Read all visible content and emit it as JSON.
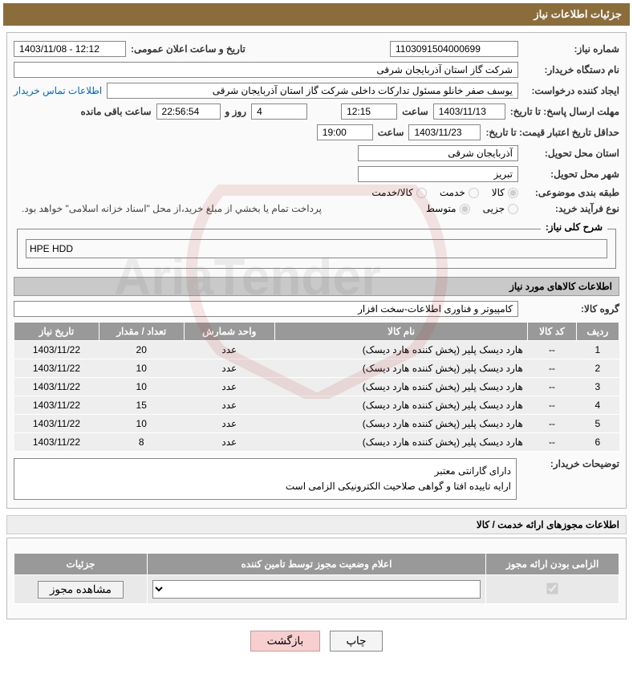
{
  "header": {
    "title": "جزئیات اطلاعات نیاز"
  },
  "info": {
    "need_number_label": "شماره نیاز:",
    "need_number": "1103091504000699",
    "announce_label": "تاریخ و ساعت اعلان عمومی:",
    "announce_value": "1403/11/08 - 12:12",
    "buyer_device_label": "نام دستگاه خریدار:",
    "buyer_device": "شرکت گاز استان آذربایجان شرقی",
    "requester_label": "ایجاد کننده درخواست:",
    "requester": "یوسف صفر خانلو  مسئول تدارکات داخلی  شرکت گاز استان آذربایجان شرقی",
    "contact_link": "اطلاعات تماس خریدار",
    "deadline_send_label": "مهلت ارسال پاسخ: تا تاریخ:",
    "deadline_send_date": "1403/11/13",
    "saat_label": "ساعت",
    "deadline_send_time": "12:15",
    "remain_days": "4",
    "remain_days_label": "روز و",
    "remain_time": "22:56:54",
    "remain_time_label": "ساعت باقی مانده",
    "min_valid_label": "حداقل تاریخ اعتبار قیمت: تا تاریخ:",
    "min_valid_date": "1403/11/23",
    "min_valid_time": "19:00",
    "province_label": "استان محل تحویل:",
    "province": "آذربایجان شرقی",
    "city_label": "شهر محل تحویل:",
    "city": "تبریز",
    "cat_label": "طبقه بندی موضوعی:",
    "cat_kala": "کالا",
    "cat_service": "خدمت",
    "cat_both": "کالا/خدمت",
    "buy_process_label": "نوع فرآیند خرید:",
    "bp_partial": "جزیی",
    "bp_medium": "متوسط",
    "buy_note": "پرداخت تمام يا بخشي از مبلغ خريد،از محل \"اسناد خزانه اسلامی\" خواهد بود."
  },
  "summary": {
    "legend": "شرح کلی نیاز:",
    "value": "HPE HDD"
  },
  "goods_section_title": "اطلاعات کالاهای مورد نیاز",
  "goods_group": {
    "label": "گروه کالا:",
    "value": "کامپیوتر و فناوری اطلاعات-سخت افزار"
  },
  "table": {
    "headers": {
      "row": "ردیف",
      "code": "کد کالا",
      "name": "نام کالا",
      "unit": "واحد شمارش",
      "qty": "تعداد / مقدار",
      "date": "تاریخ نیاز"
    },
    "rows": [
      {
        "idx": "1",
        "code": "--",
        "name": "هارد دیسک پلیر (پخش‌ کننده هارد دیسک)",
        "unit": "عدد",
        "qty": "20",
        "date": "1403/11/22"
      },
      {
        "idx": "2",
        "code": "--",
        "name": "هارد دیسک پلیر (پخش‌ کننده هارد دیسک)",
        "unit": "عدد",
        "qty": "10",
        "date": "1403/11/22"
      },
      {
        "idx": "3",
        "code": "--",
        "name": "هارد دیسک پلیر (پخش‌ کننده هارد دیسک)",
        "unit": "عدد",
        "qty": "10",
        "date": "1403/11/22"
      },
      {
        "idx": "4",
        "code": "--",
        "name": "هارد دیسک پلیر (پخش‌ کننده هارد دیسک)",
        "unit": "عدد",
        "qty": "15",
        "date": "1403/11/22"
      },
      {
        "idx": "5",
        "code": "--",
        "name": "هارد دیسک پلیر (پخش‌ کننده هارد دیسک)",
        "unit": "عدد",
        "qty": "10",
        "date": "1403/11/22"
      },
      {
        "idx": "6",
        "code": "--",
        "name": "هارد دیسک پلیر (پخش‌ کننده هارد دیسک)",
        "unit": "عدد",
        "qty": "8",
        "date": "1403/11/22"
      }
    ]
  },
  "buyer_notes": {
    "label": "توضیحات خریدار:",
    "line1": "دارای گارانتی معتبر",
    "line2": "ارایه تاییده افتا و گواهی صلاحیت الکترونیکی الزامی است"
  },
  "license": {
    "section_title": "اطلاعات مجوزهای ارائه خدمت / کالا",
    "headers": {
      "required": "الزامی بودن ارائه مجوز",
      "status": "اعلام وضعیت مجوز توسط تامین کننده",
      "details": "جزئیات"
    },
    "view_btn": "مشاهده مجوز"
  },
  "footer": {
    "print": "چاپ",
    "back": "بازگشت"
  }
}
